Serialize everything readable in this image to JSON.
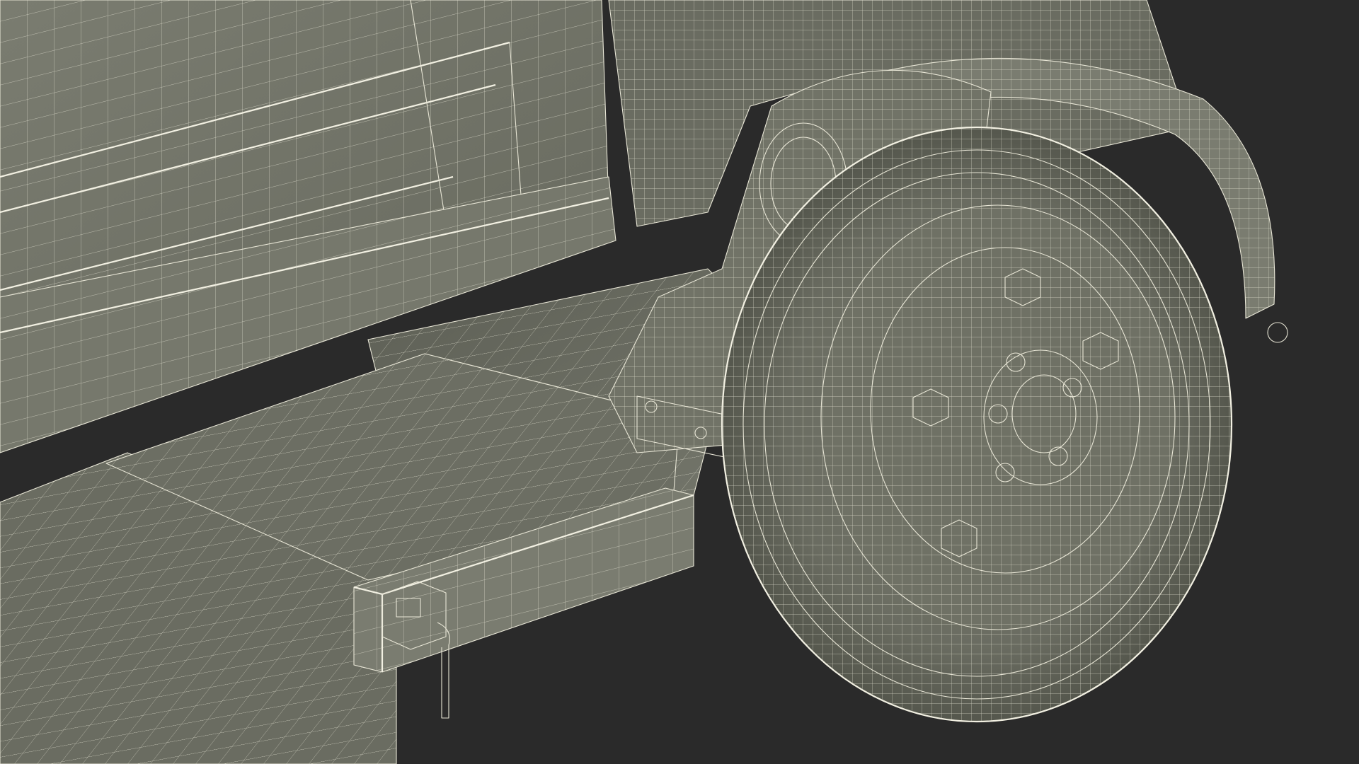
{
  "scene": {
    "background_color": "#2a2a2a",
    "surface_color": "#6f7165",
    "surface_shadow_color": "#4e5047",
    "wire_color": "#e8e6d6",
    "parts": [
      "vehicle-body-side-panel",
      "rocker-panel",
      "undercarriage-floor",
      "cargo-platform",
      "frame-rail",
      "mounting-bracket",
      "rear-fender",
      "fender-flare",
      "tail-light-housing",
      "spare-tire",
      "wheel-rim",
      "wheel-hub",
      "lug-nuts",
      "tow-hook"
    ]
  }
}
